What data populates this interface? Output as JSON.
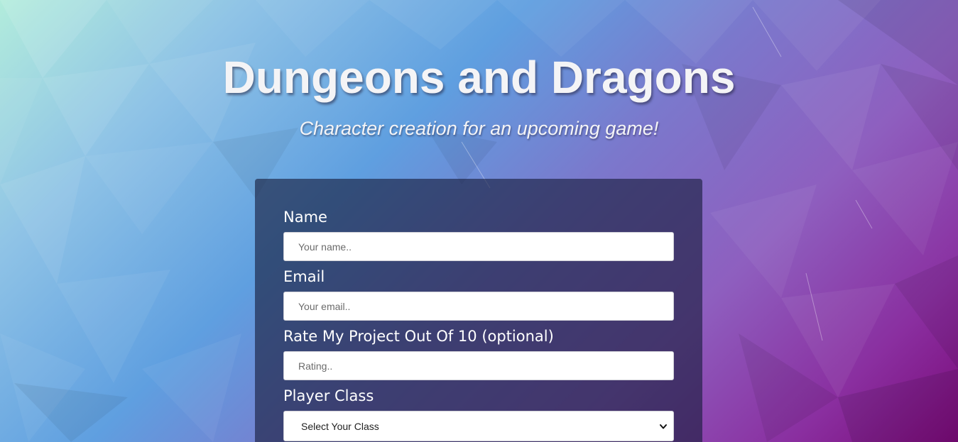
{
  "header": {
    "title": "Dungeons and Dragons",
    "subtitle": "Character creation for an upcoming game!"
  },
  "form": {
    "name": {
      "label": "Name",
      "placeholder": "Your name.."
    },
    "email": {
      "label": "Email",
      "placeholder": "Your email.."
    },
    "rating": {
      "label": "Rate My Project Out Of 10 (optional)",
      "placeholder": "Rating.."
    },
    "player_class": {
      "label": "Player Class",
      "selected": "Select Your Class"
    }
  },
  "icons": {
    "select_arrow": "chevron-down-icon"
  },
  "colors": {
    "panel_background": "#161c3a",
    "text_light": "#ffffff",
    "background_top_left": "#b2ecdc",
    "background_bottom_right": "#7a0a78"
  }
}
